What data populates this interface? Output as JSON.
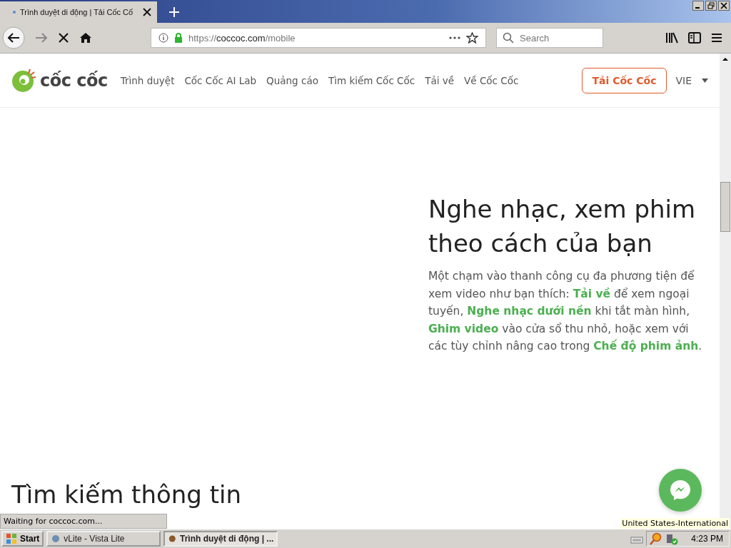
{
  "browser": {
    "tab": {
      "title": "Trình duyệt di động | Tải Cốc Cố",
      "selected": true
    },
    "url": {
      "prefix": "https://",
      "host": "coccoc.com",
      "path": "/mobile"
    },
    "search": {
      "placeholder": "Search"
    }
  },
  "site": {
    "logo": "cốc cốc",
    "nav": [
      {
        "label": "Trình duyệt"
      },
      {
        "label": "Cốc Cốc AI Lab"
      },
      {
        "label": "Quảng cáo"
      },
      {
        "label": "Tìm kiếm Cốc Cốc"
      },
      {
        "label": "Tải về"
      },
      {
        "label": "Về Cốc Cốc"
      }
    ],
    "download_button": "Tải Cốc Cốc",
    "language": "VIE"
  },
  "hero": {
    "heading": "Nghe nhạc, xem phim theo cách của bạn",
    "paragraph": "Một chạm vào thanh công cụ đa phương tiện để xem video như bạn thích: **Tải về** để xem ngoại tuyến, **Nghe nhạc dưới nền** khi tắt màn hình, **Ghim video** vào cửa sổ thu nhỏ, hoặc xem với các tùy chỉnh nâng cao trong **Chế độ phim ảnh**."
  },
  "next_heading": "Tìm kiếm thông tin",
  "status_text": "Waiting for coccoc.com...",
  "tooltip": "United States-International",
  "taskbar": {
    "start": "Start",
    "tasks": [
      {
        "label": "vLite - Vista Lite",
        "selected": false
      },
      {
        "label": "Trình duyệt di động | ...",
        "selected": true
      }
    ],
    "clock": "4:23 PM"
  }
}
